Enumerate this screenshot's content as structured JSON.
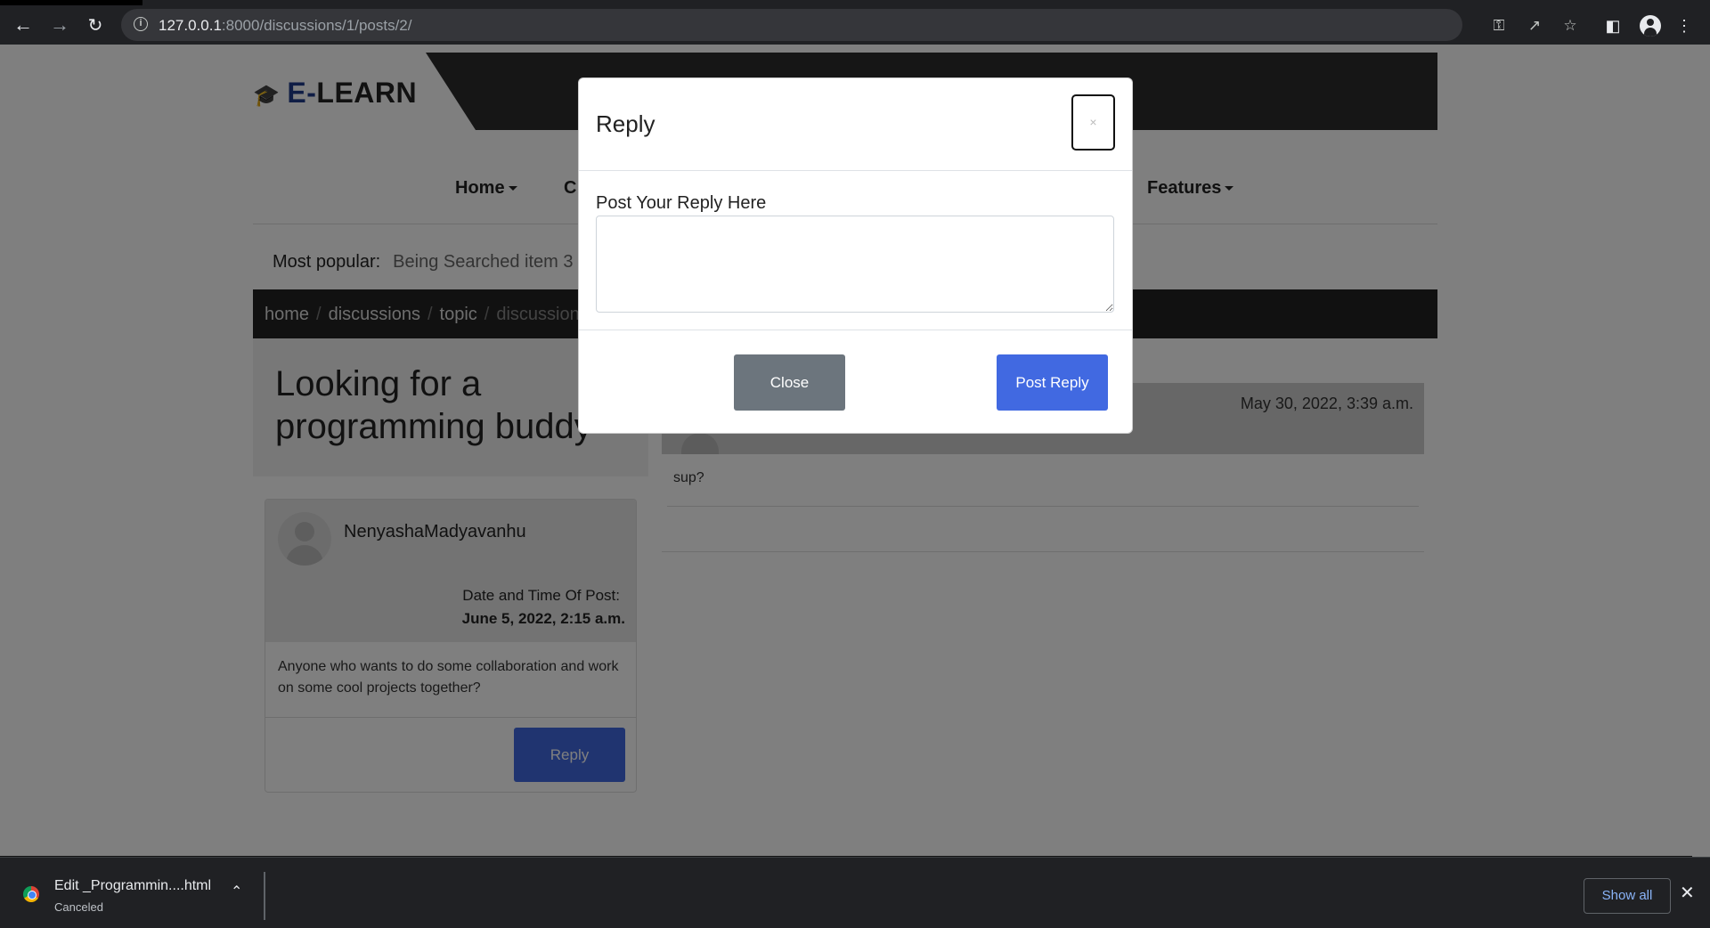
{
  "browser": {
    "url_host": "127.0.0.1",
    "url_rest": ":8000/discussions/1/posts/2/"
  },
  "site": {
    "logo_prefix": "E-",
    "logo_rest": "LEARN"
  },
  "nav": {
    "home": "Home",
    "partial": "C",
    "features": "Features"
  },
  "popular": {
    "label": "Most popular:",
    "item": "Being Searched item 3"
  },
  "breadcrumb": {
    "home": "home",
    "discussions": "discussions",
    "topic": "topic",
    "current": "discussion",
    "sep": "/"
  },
  "post": {
    "title": "Looking for a programming buddy",
    "username": "NenyashaMadyavanhu",
    "datetime_label": "Date and Time Of Post:",
    "datetime_value": "June 5, 2022, 2:15 a.m.",
    "body": "Anyone who wants to do some collaboration and work on some cool projects together?",
    "reply_button": "Reply"
  },
  "reply": {
    "date": "May 30, 2022, 3:39 a.m.",
    "text": "sup?"
  },
  "modal": {
    "title": "Reply",
    "close_symbol": "×",
    "field_label": "Post Your Reply Here",
    "textarea_value": "",
    "close_button": "Close",
    "post_button": "Post Reply"
  },
  "downloads": {
    "file_name": "Edit _Programmin....html",
    "status": "Canceled",
    "show_all": "Show all"
  }
}
